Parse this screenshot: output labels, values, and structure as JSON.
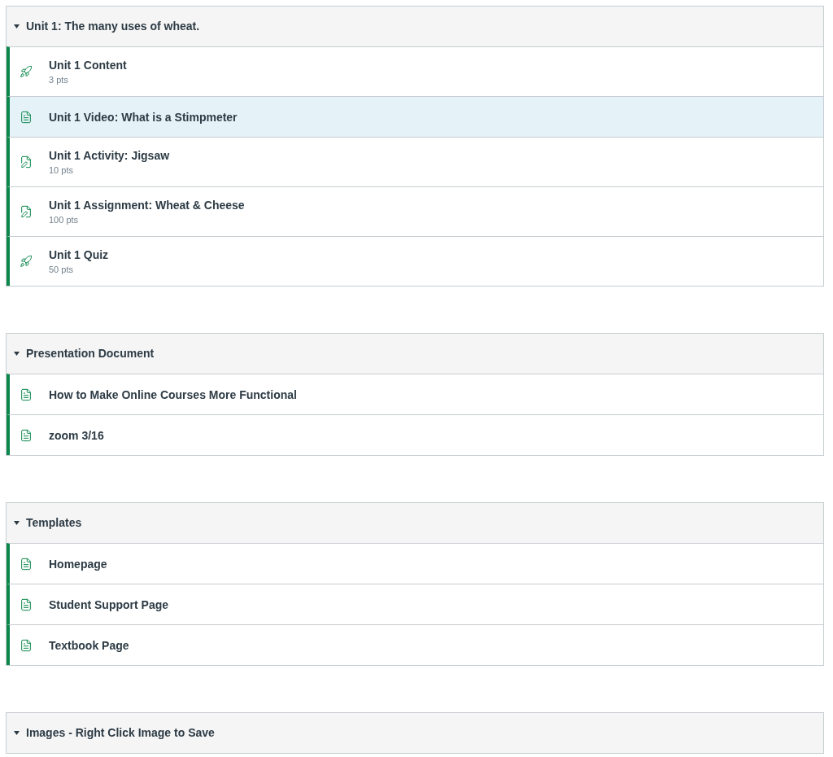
{
  "modules": [
    {
      "title": "Unit 1: The many uses of wheat.",
      "expanded": true,
      "items": [
        {
          "kind": "quiz",
          "title": "Unit 1 Content",
          "points": "3 pts",
          "selected": false
        },
        {
          "kind": "page",
          "title": "Unit 1 Video: What is a Stimpmeter",
          "selected": true
        },
        {
          "kind": "assignment",
          "title": "Unit 1 Activity: Jigsaw",
          "points": "10 pts",
          "selected": false
        },
        {
          "kind": "assignment",
          "title": "Unit 1 Assignment: Wheat & Cheese",
          "points": "100 pts",
          "selected": false
        },
        {
          "kind": "quiz",
          "title": "Unit 1 Quiz",
          "points": "50 pts",
          "selected": false
        }
      ]
    },
    {
      "title": "Presentation Document",
      "expanded": true,
      "items": [
        {
          "kind": "page",
          "title": "How to Make Online Courses More Functional",
          "selected": false
        },
        {
          "kind": "page",
          "title": "zoom 3/16",
          "selected": false
        }
      ]
    },
    {
      "title": "Templates",
      "expanded": true,
      "items": [
        {
          "kind": "page",
          "title": "Homepage",
          "selected": false
        },
        {
          "kind": "page",
          "title": "Student Support Page",
          "selected": false
        },
        {
          "kind": "page",
          "title": "Textbook Page",
          "selected": false
        }
      ]
    },
    {
      "title": "Images - Right Click Image to Save",
      "expanded": true
    }
  ]
}
